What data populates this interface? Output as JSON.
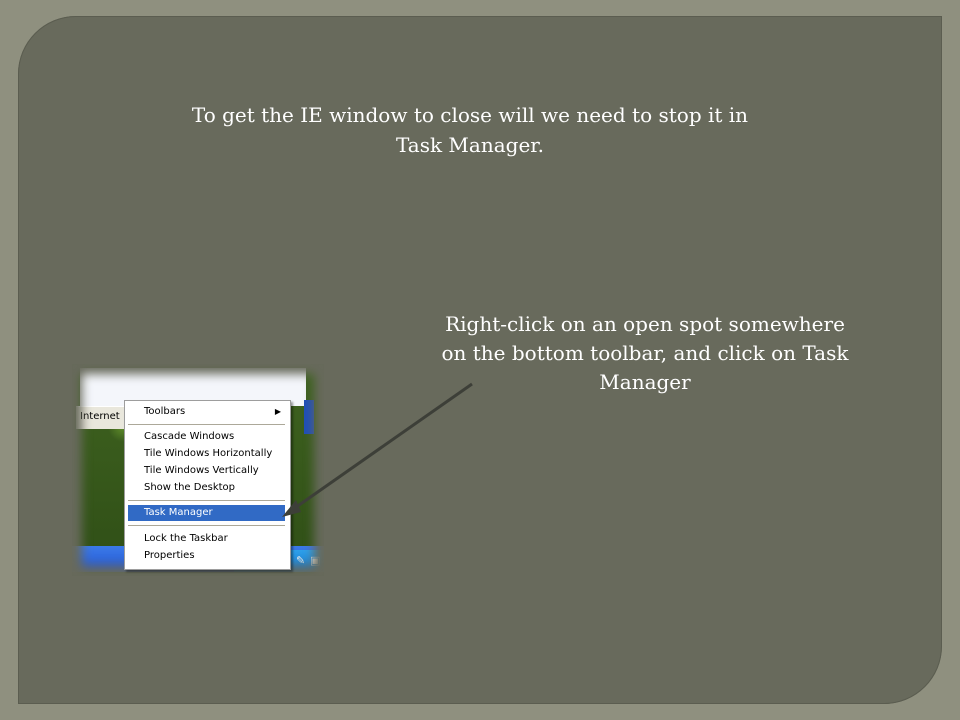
{
  "slide": {
    "title": "To get the IE window  to close will we need to stop it in Task Manager.",
    "instruction": "Right-click on an open spot somewhere on the bottom toolbar, and click on Task Manager"
  },
  "screenshot": {
    "taskbar_button": "Internet",
    "context_menu": {
      "items": [
        {
          "label": "Toolbars",
          "has_submenu": true
        },
        {
          "label": "Cascade Windows"
        },
        {
          "label": "Tile Windows Horizontally"
        },
        {
          "label": "Tile Windows Vertically"
        },
        {
          "label": "Show the Desktop"
        },
        {
          "label": "Task Manager",
          "selected": true
        },
        {
          "label": "Lock the Taskbar"
        },
        {
          "label": "Properties"
        }
      ],
      "submenu_arrow": "▶",
      "selection_color": "#316ac5"
    },
    "tray_icon_labels": [
      "ou"
    ]
  },
  "colors": {
    "page_background": "#8f907f",
    "slide_panel": "#686a5c",
    "text": "#ffffff",
    "arrow": "#3d3f38"
  }
}
